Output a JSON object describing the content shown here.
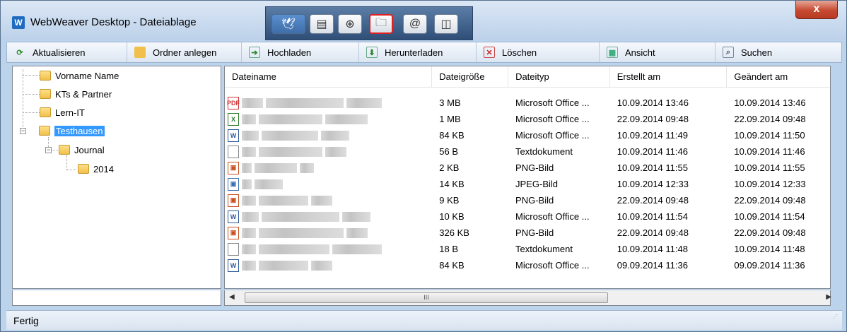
{
  "window": {
    "app_icon_letter": "W",
    "title": "WebWeaver Desktop - Dateiablage",
    "close_label": "x"
  },
  "modebar": {
    "buttons": [
      {
        "icon": "webweaver-logo-icon",
        "glyph": "🕊"
      },
      {
        "icon": "message-icon",
        "glyph": "▤"
      },
      {
        "icon": "globe-icon",
        "glyph": "⊕"
      },
      {
        "icon": "folder-icon",
        "glyph": "🗀"
      },
      {
        "icon": "email-icon",
        "glyph": "@"
      },
      {
        "icon": "storage-icon",
        "glyph": "◫"
      }
    ]
  },
  "toolbar": {
    "refresh": "Aktualisieren",
    "new_folder": "Ordner anlegen",
    "upload": "Hochladen",
    "download": "Herunterladen",
    "delete": "Löschen",
    "view": "Ansicht",
    "search": "Suchen"
  },
  "tree": {
    "nodes": [
      {
        "label": "Vorname Name"
      },
      {
        "label": "KTs & Partner"
      },
      {
        "label": "Lern-IT"
      },
      {
        "label": "Testhausen",
        "selected": true
      },
      {
        "label": "Journal"
      },
      {
        "label": "2014"
      }
    ],
    "expander_minus": "−"
  },
  "list": {
    "columns": [
      "Dateiname",
      "Dateigröße",
      "Dateityp",
      "Erstellt am",
      "Geändert am"
    ],
    "rows": [
      {
        "icon": "pdf-icon",
        "size": "3 MB",
        "type": "Microsoft Office ...",
        "created": "10.09.2014 13:46",
        "modified": "10.09.2014 13:46"
      },
      {
        "icon": "excel-icon",
        "size": "1 MB",
        "type": "Microsoft Office ...",
        "created": "22.09.2014 09:48",
        "modified": "22.09.2014 09:48"
      },
      {
        "icon": "word-icon",
        "size": "84 KB",
        "type": "Microsoft Office ...",
        "created": "10.09.2014 11:49",
        "modified": "10.09.2014 11:50"
      },
      {
        "icon": "text-file-icon",
        "size": "56 B",
        "type": "Textdokument",
        "created": "10.09.2014 11:46",
        "modified": "10.09.2014 11:46"
      },
      {
        "icon": "png-icon",
        "size": "2 KB",
        "type": "PNG-Bild",
        "created": "10.09.2014 11:55",
        "modified": "10.09.2014 11:55"
      },
      {
        "icon": "jpeg-icon",
        "size": "14 KB",
        "type": "JPEG-Bild",
        "created": "10.09.2014 12:33",
        "modified": "10.09.2014 12:33"
      },
      {
        "icon": "png-icon",
        "size": "9 KB",
        "type": "PNG-Bild",
        "created": "22.09.2014 09:48",
        "modified": "22.09.2014 09:48"
      },
      {
        "icon": "word-icon",
        "size": "10 KB",
        "type": "Microsoft Office ...",
        "created": "10.09.2014 11:54",
        "modified": "10.09.2014 11:54"
      },
      {
        "icon": "png-icon",
        "size": "326 KB",
        "type": "PNG-Bild",
        "created": "22.09.2014 09:48",
        "modified": "22.09.2014 09:48"
      },
      {
        "icon": "text-file-icon",
        "size": "18 B",
        "type": "Textdokument",
        "created": "10.09.2014 11:48",
        "modified": "10.09.2014 11:48"
      },
      {
        "icon": "word-icon",
        "size": "84 KB",
        "type": "Microsoft Office ...",
        "created": "09.09.2014 11:36",
        "modified": "09.09.2014 11:36"
      }
    ]
  },
  "scrollbar": {
    "thumb_grip": "III",
    "left_arrow": "◀",
    "right_arrow": "▶"
  },
  "status": {
    "text": "Fertig"
  },
  "colors": {
    "selection": "#3399ff",
    "titlebar": "#bcd1ea",
    "close": "#c64a31",
    "active_mode_border": "#e02020"
  }
}
